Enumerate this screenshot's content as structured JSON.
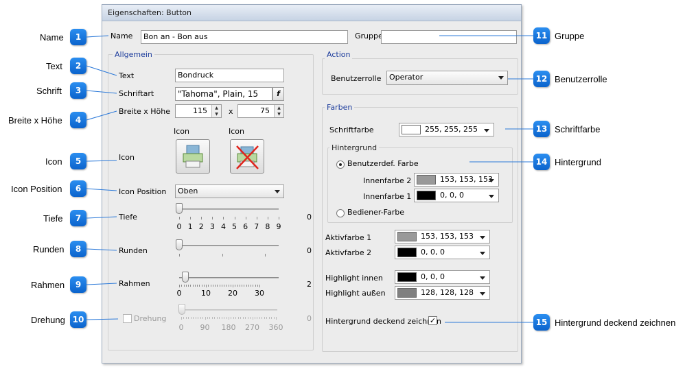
{
  "dialog": {
    "title": "Eigenschaften: Button"
  },
  "top": {
    "name_label": "Name",
    "name_value": "Bon an - Bon aus",
    "gruppe_label": "Gruppe",
    "gruppe_value": ""
  },
  "allgemein": {
    "title": "Allgemein",
    "text_label": "Text",
    "text_value": "Bondruck",
    "schriftart_label": "Schriftart",
    "schriftart_value": "\"Tahoma\", Plain, 15",
    "font_button_glyph": "f",
    "groesse_label": "Breite x Höhe",
    "breite_value": "115",
    "x_sep": "x",
    "hoehe_value": "75",
    "icon_header1": "Icon",
    "icon_header2": "Icon",
    "icon_label": "Icon",
    "iconpos_label": "Icon Position",
    "iconpos_value": "Oben",
    "tiefe_label": "Tiefe",
    "tiefe_value": "0",
    "tiefe_ticks": [
      "0",
      "1",
      "2",
      "3",
      "4",
      "5",
      "6",
      "7",
      "8",
      "9"
    ],
    "runden_label": "Runden",
    "runden_value": "0",
    "rahmen_label": "Rahmen",
    "rahmen_value": "2",
    "rahmen_ticks": [
      "0",
      "10",
      "20",
      "30"
    ],
    "drehung_label": "Drehung",
    "drehung_value": "0",
    "drehung_checked": false,
    "drehung_ticks": [
      "0",
      "90",
      "180",
      "270",
      "360"
    ]
  },
  "action": {
    "title": "Action",
    "rolle_label": "Benutzerrolle",
    "rolle_value": "Operator"
  },
  "farben": {
    "title": "Farben",
    "schriftfarbe_label": "Schriftfarbe",
    "schriftfarbe_value": "255, 255, 255",
    "schriftfarbe_color": "#ffffff",
    "hintergrund_title": "Hintergrund",
    "benutzerdef_label": "Benutzerdef. Farbe",
    "innen2_label": "Innenfarbe 2",
    "innen2_value": "153, 153, 153",
    "innen2_color": "#999999",
    "innen1_label": "Innenfarbe 1",
    "innen1_value": "0, 0, 0",
    "innen1_color": "#000000",
    "bediener_label": "Bediener-Farbe",
    "aktiv1_label": "Aktivfarbe 1",
    "aktiv1_value": "153, 153, 153",
    "aktiv1_color": "#999999",
    "aktiv2_label": "Aktivfarbe 2",
    "aktiv2_value": "0, 0, 0",
    "aktiv2_color": "#000000",
    "hl_innen_label": "Highlight innen",
    "hl_innen_value": "0, 0, 0",
    "hl_innen_color": "#000000",
    "hl_aussen_label": "Highlight außen",
    "hl_aussen_value": "128, 128, 128",
    "hl_aussen_color": "#808080",
    "deckend_label": "Hintergrund deckend zeichnen",
    "deckend_checked": true,
    "check_glyph": "✓"
  },
  "callouts": [
    {
      "num": "1",
      "label": "Name"
    },
    {
      "num": "2",
      "label": "Text"
    },
    {
      "num": "3",
      "label": "Schrift"
    },
    {
      "num": "4",
      "label": "Breite x Höhe"
    },
    {
      "num": "5",
      "label": "Icon"
    },
    {
      "num": "6",
      "label": "Icon Position"
    },
    {
      "num": "7",
      "label": "Tiefe"
    },
    {
      "num": "8",
      "label": "Runden"
    },
    {
      "num": "9",
      "label": "Rahmen"
    },
    {
      "num": "10",
      "label": "Drehung"
    },
    {
      "num": "11",
      "label": "Gruppe"
    },
    {
      "num": "12",
      "label": "Benutzerrolle"
    },
    {
      "num": "13",
      "label": "Schriftfarbe"
    },
    {
      "num": "14",
      "label": "Hintergrund"
    },
    {
      "num": "15",
      "label": "Hintergrund deckend zeichnen"
    }
  ],
  "colors": {
    "accent": "#1c3c9c",
    "callout": "#0b63cc"
  }
}
